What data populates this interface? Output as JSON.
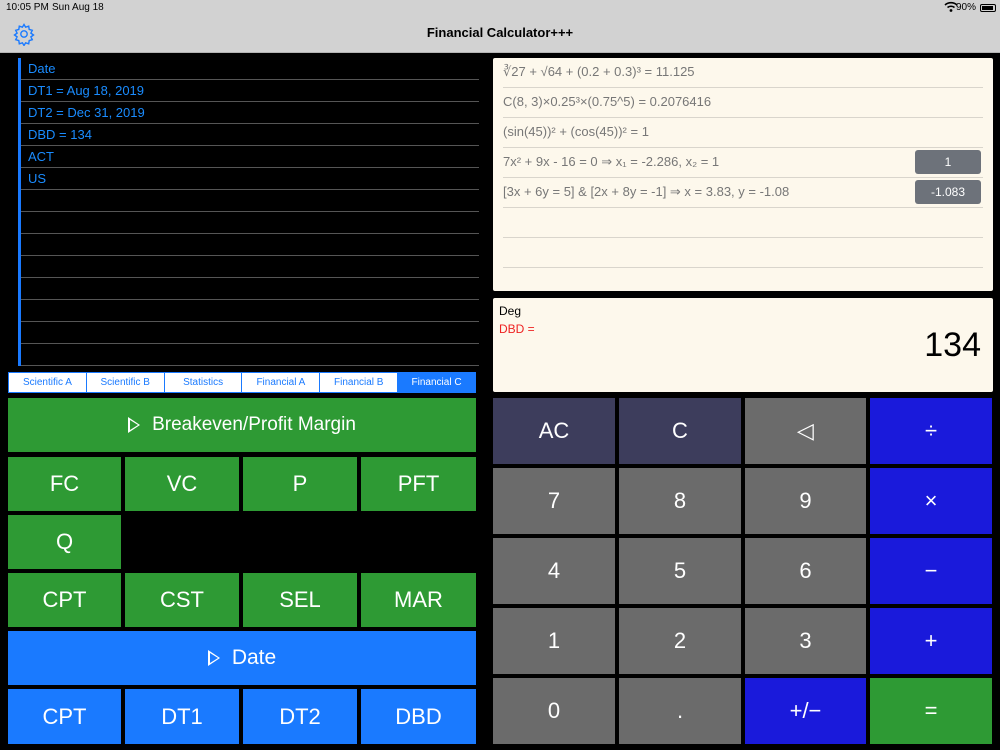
{
  "status": {
    "time": "10:05 PM",
    "date": "Sun Aug 18",
    "battery": "90%"
  },
  "nav": {
    "title": "Financial Calculator+++",
    "settings_icon": "gear-icon"
  },
  "register": {
    "rows": [
      "Date",
      "DT1 = Aug 18, 2019",
      "DT2 = Dec 31, 2019",
      "DBD = 134",
      "ACT",
      "US",
      "",
      "",
      "",
      "",
      "",
      "",
      "",
      ""
    ]
  },
  "tabs": [
    "Scientific A",
    "Scientific B",
    "Statistics",
    "Financial A",
    "Financial B",
    "Financial C"
  ],
  "active_tab": "Financial C",
  "breakeven": {
    "header": "Breakeven/Profit Margin",
    "keys_row1": [
      "FC",
      "VC",
      "P",
      "PFT"
    ],
    "keys_row2": [
      "Q"
    ],
    "keys_row3": [
      "CPT",
      "CST",
      "SEL",
      "MAR"
    ]
  },
  "date_section": {
    "header": "Date",
    "keys": [
      "CPT",
      "DT1",
      "DT2",
      "DBD"
    ]
  },
  "history": {
    "rows": [
      {
        "text": "∛27 + √64 + (0.2 + 0.3)³ = 11.125",
        "button": ""
      },
      {
        "text": "C(8, 3)×0.25³×(0.75^5) = 0.2076416",
        "button": ""
      },
      {
        "text": "(sin(45))² + (cos(45))² = 1",
        "button": ""
      },
      {
        "text": "7x² + 9x - 16 = 0      ⇒      x₁ = -2.286, x₂ = 1",
        "button": "1"
      },
      {
        "text": "[3x + 6y = 5]  &  [2x + 8y = -1] ⇒ x = 3.83, y = -1.08",
        "button": "-1.083"
      },
      {
        "text": "",
        "button": ""
      },
      {
        "text": "",
        "button": ""
      }
    ]
  },
  "display": {
    "mode": "Deg",
    "label": "DBD =",
    "value": "134"
  },
  "keypad": {
    "row1": [
      "AC",
      "C",
      "◁",
      "÷"
    ],
    "row2": [
      "7",
      "8",
      "9",
      "×"
    ],
    "row3": [
      "4",
      "5",
      "6",
      "−"
    ],
    "row4": [
      "1",
      "2",
      "3",
      "+"
    ],
    "row5": [
      "0",
      ".",
      "+/−",
      "="
    ]
  },
  "colors": {
    "accent": "#1a7aff",
    "green": "#2e9a34",
    "gray_key": "#6b6b6b",
    "clear_key": "#3d3d5c",
    "operator_key": "#1a1adb",
    "display_bg": "#fdf8ec"
  }
}
